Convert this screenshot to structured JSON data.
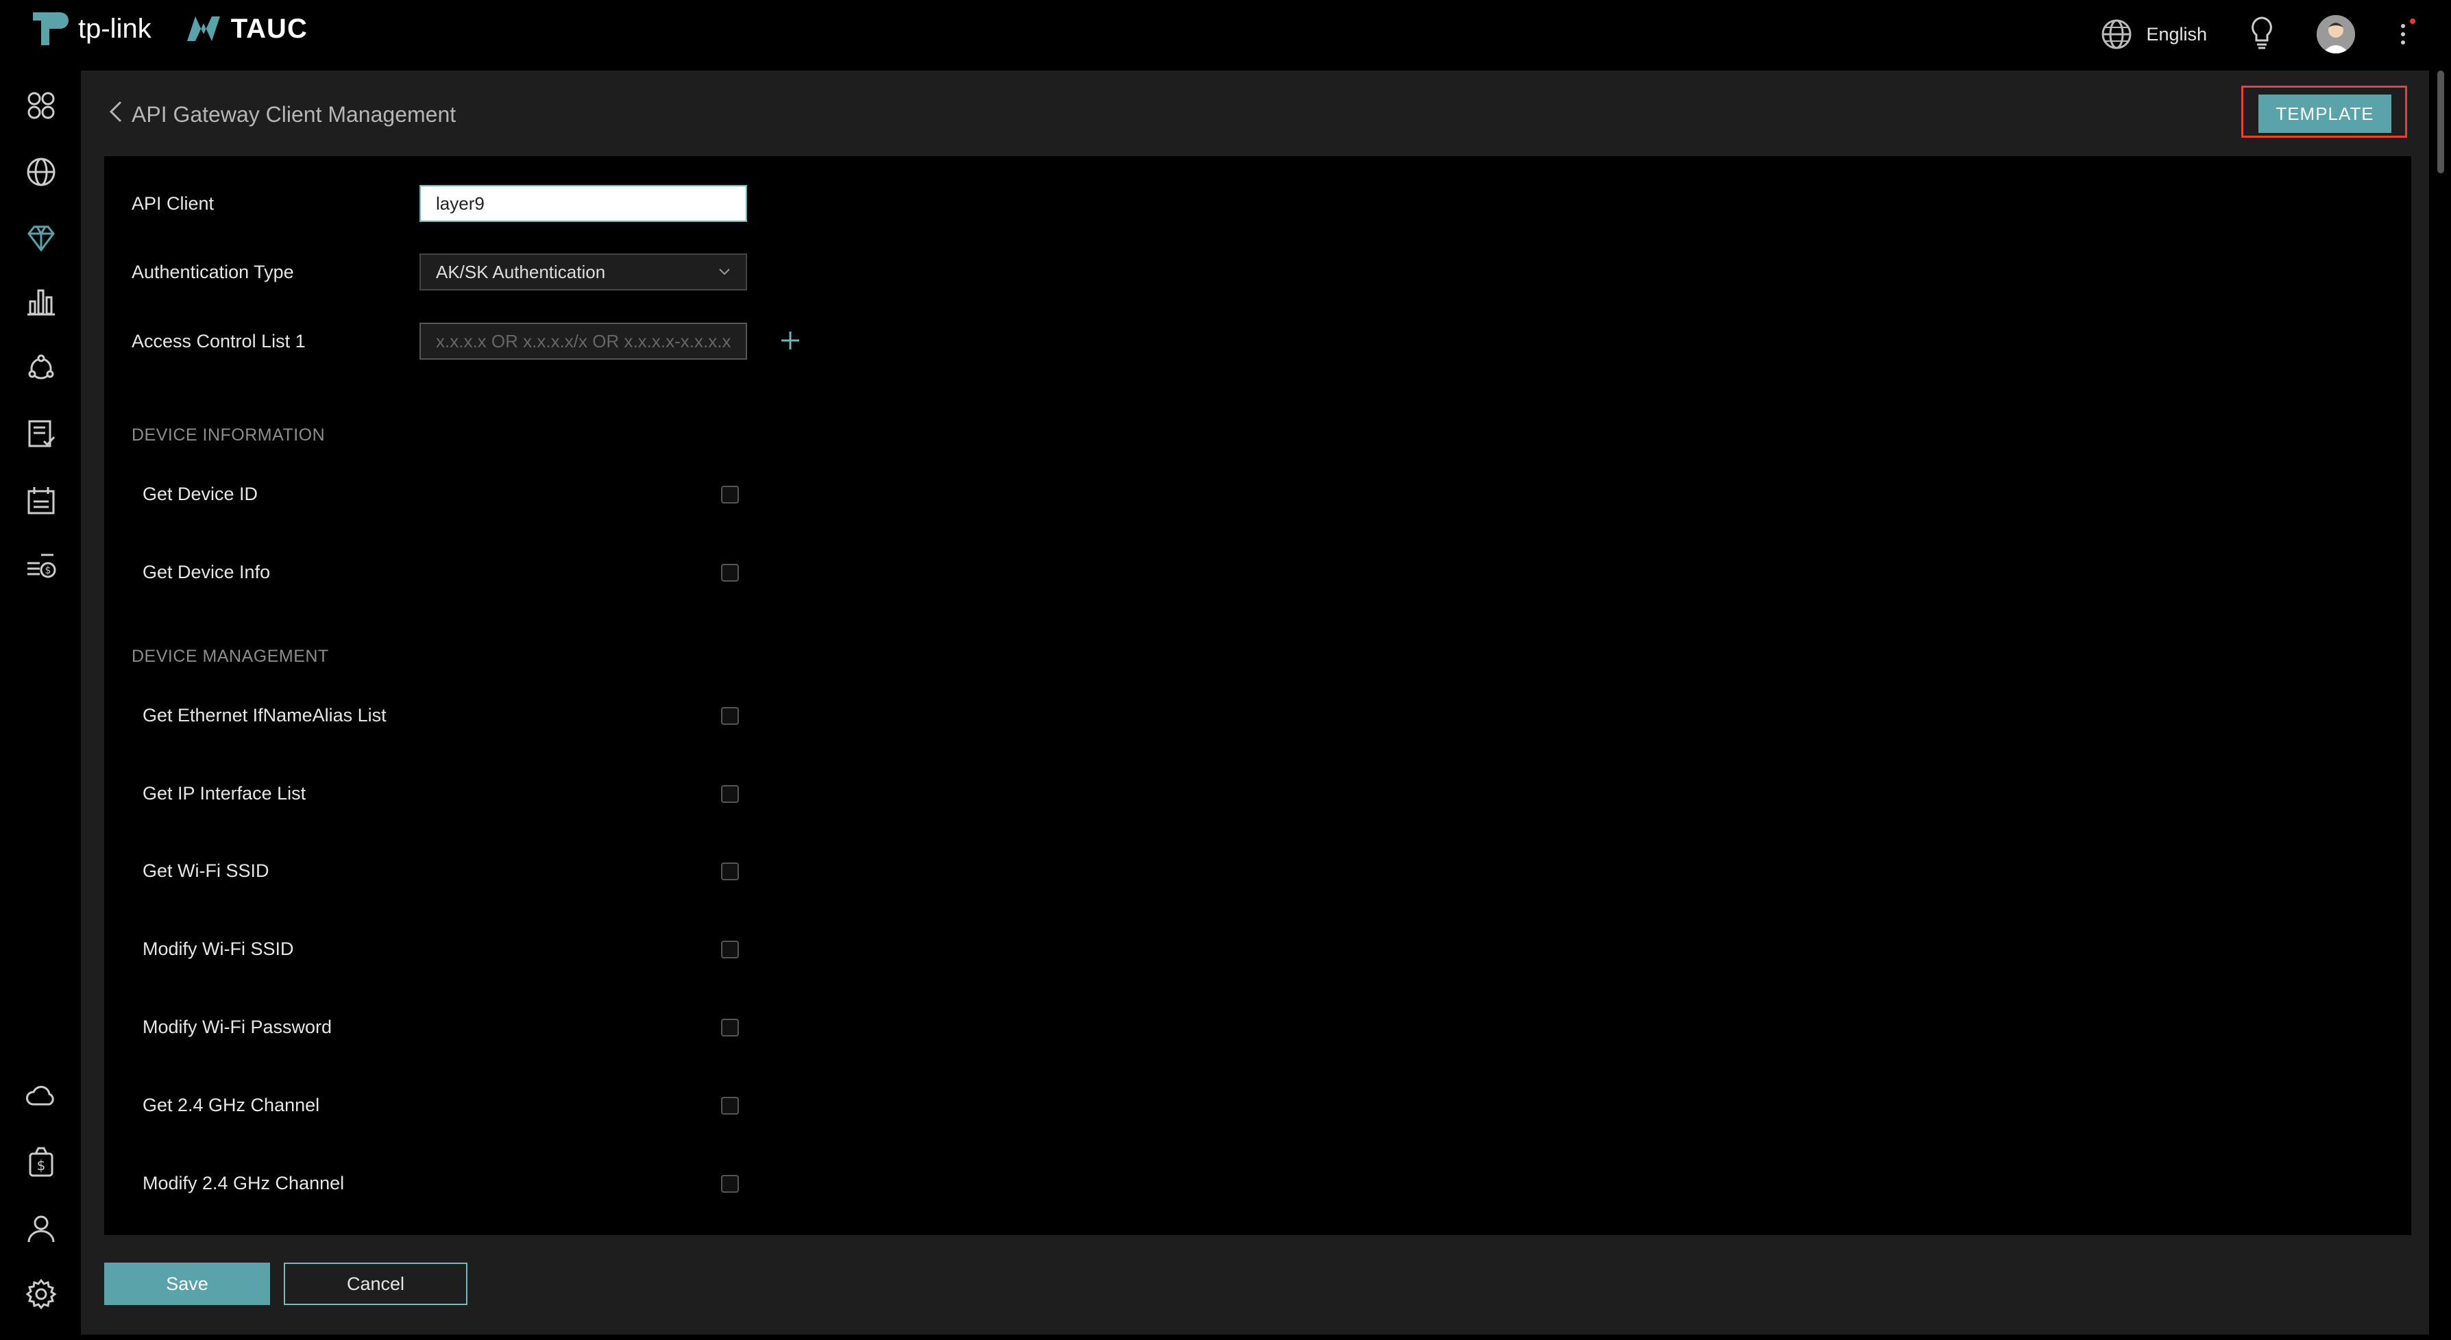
{
  "topbar": {
    "brand_name": "tp-link",
    "product_name": "TAUC",
    "language": "English"
  },
  "header": {
    "title": "API Gateway Client Management",
    "template_label": "TEMPLATE"
  },
  "form": {
    "api_client_label": "API Client",
    "api_client_value": "layer9",
    "auth_type_label": "Authentication Type",
    "auth_type_value": "AK/SK Authentication",
    "acl_label": "Access Control List 1",
    "acl_placeholder": "x.x.x.x OR x.x.x.x/x OR x.x.x.x-x.x.x.x"
  },
  "sections": {
    "device_information": {
      "title": "DEVICE INFORMATION",
      "items": [
        "Get Device ID",
        "Get Device Info"
      ]
    },
    "device_management": {
      "title": "DEVICE MANAGEMENT",
      "items": [
        "Get Ethernet IfNameAlias List",
        "Get IP Interface List",
        "Get Wi-Fi SSID",
        "Modify Wi-Fi SSID",
        "Modify Wi-Fi Password",
        "Get 2.4 GHz Channel",
        "Modify 2.4 GHz Channel"
      ]
    }
  },
  "footer": {
    "save_label": "Save",
    "cancel_label": "Cancel"
  },
  "colors": {
    "accent": "#5ba3ab",
    "highlight_border": "#e2452b",
    "panel_bg": "#1e1e1e"
  }
}
